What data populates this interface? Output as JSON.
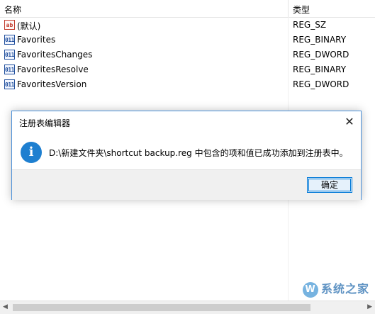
{
  "list": {
    "headers": {
      "name": "名称",
      "type": "类型"
    },
    "rows": [
      {
        "icon": "string-value-icon",
        "glyph": "ab",
        "name": "(默认)",
        "type": "REG_SZ"
      },
      {
        "icon": "binary-value-icon",
        "glyph": "011",
        "name": "Favorites",
        "type": "REG_BINARY"
      },
      {
        "icon": "binary-value-icon",
        "glyph": "011",
        "name": "FavoritesChanges",
        "type": "REG_DWORD"
      },
      {
        "icon": "binary-value-icon",
        "glyph": "011",
        "name": "FavoritesResolve",
        "type": "REG_BINARY"
      },
      {
        "icon": "binary-value-icon",
        "glyph": "011",
        "name": "FavoritesVersion",
        "type": "REG_DWORD"
      }
    ]
  },
  "dialog": {
    "title": "注册表编辑器",
    "close_glyph": "✕",
    "info_glyph": "i",
    "message": "D:\\新建文件夹\\shortcut backup.reg 中包含的项和值已成功添加到注册表中。",
    "ok_label": "确定"
  },
  "scrollbar": {
    "left_arrow": "◀",
    "right_arrow": "▶"
  },
  "watermark": {
    "text": "系统之家",
    "badge": "W"
  },
  "colors": {
    "accent": "#0078d7",
    "info_icon": "#1e7fd0",
    "footer_bg": "#f0f0f0"
  }
}
